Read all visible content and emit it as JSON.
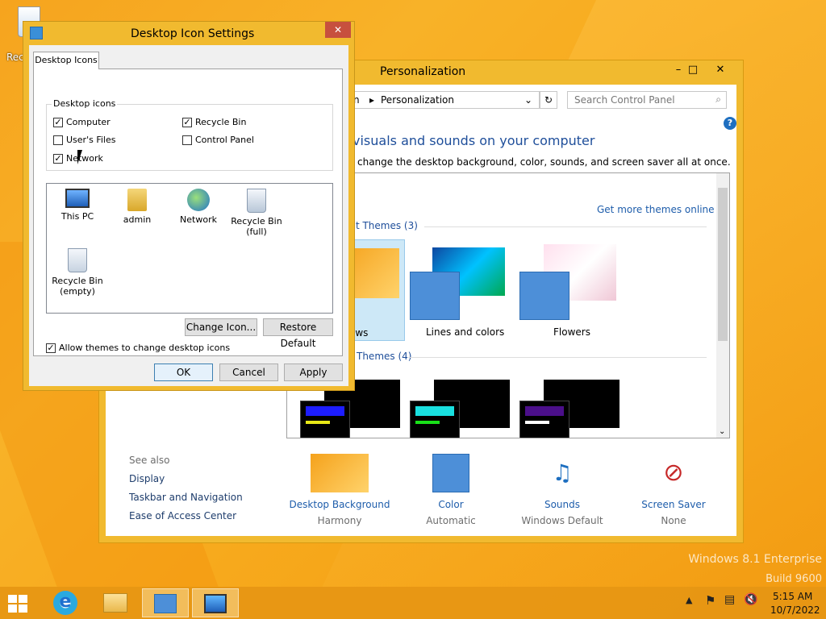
{
  "desktop": {
    "recycle_label": "Rec",
    "watermark_line1": "Windows 8.1 Enterprise",
    "watermark_line2": "Build 9600"
  },
  "personalization": {
    "title": "Personalization",
    "breadcrumb_prefix": "n",
    "breadcrumb_current": "Personalization",
    "search_placeholder": "Search Control Panel",
    "heading": "visuals and sounds on your computer",
    "subheading": "change the desktop background, color, sounds, and screen saver all at once.",
    "get_more_link": "Get more themes online",
    "group1": "ult Themes (3)",
    "group2": "Themes (4)",
    "theme_partial": "ows",
    "themes": [
      "Lines and colors",
      "Flowers"
    ],
    "see_also": {
      "header": "See also",
      "links": [
        "Display",
        "Taskbar and Navigation",
        "Ease of Access Center"
      ]
    },
    "bottom": [
      {
        "label": "Desktop Background",
        "sub": "Harmony"
      },
      {
        "label": "Color",
        "sub": "Automatic"
      },
      {
        "label": "Sounds",
        "sub": "Windows Default"
      },
      {
        "label": "Screen Saver",
        "sub": "None"
      }
    ]
  },
  "dialog": {
    "title": "Desktop Icon Settings",
    "tab": "Desktop Icons",
    "group": "Desktop icons",
    "checkboxes": [
      {
        "label": "Computer",
        "checked": true
      },
      {
        "label": "Recycle Bin",
        "checked": true
      },
      {
        "label": "User's Files",
        "checked": false
      },
      {
        "label": "Control Panel",
        "checked": false
      },
      {
        "label": "Network",
        "checked": true
      }
    ],
    "icons": [
      "This PC",
      "admin",
      "Network",
      "Recycle Bin (full)",
      "Recycle Bin (empty)"
    ],
    "change_icon": "Change Icon...",
    "restore_default": "Restore Default",
    "allow_themes": "Allow themes to change desktop icons",
    "allow_checked": true,
    "ok": "OK",
    "cancel": "Cancel",
    "apply": "Apply"
  },
  "taskbar": {
    "time": "5:15 AM",
    "date": "10/7/2022"
  },
  "colors": {
    "accent": "#f1ba2f",
    "link": "#1e5dab",
    "desktop": "#f6a41e"
  }
}
